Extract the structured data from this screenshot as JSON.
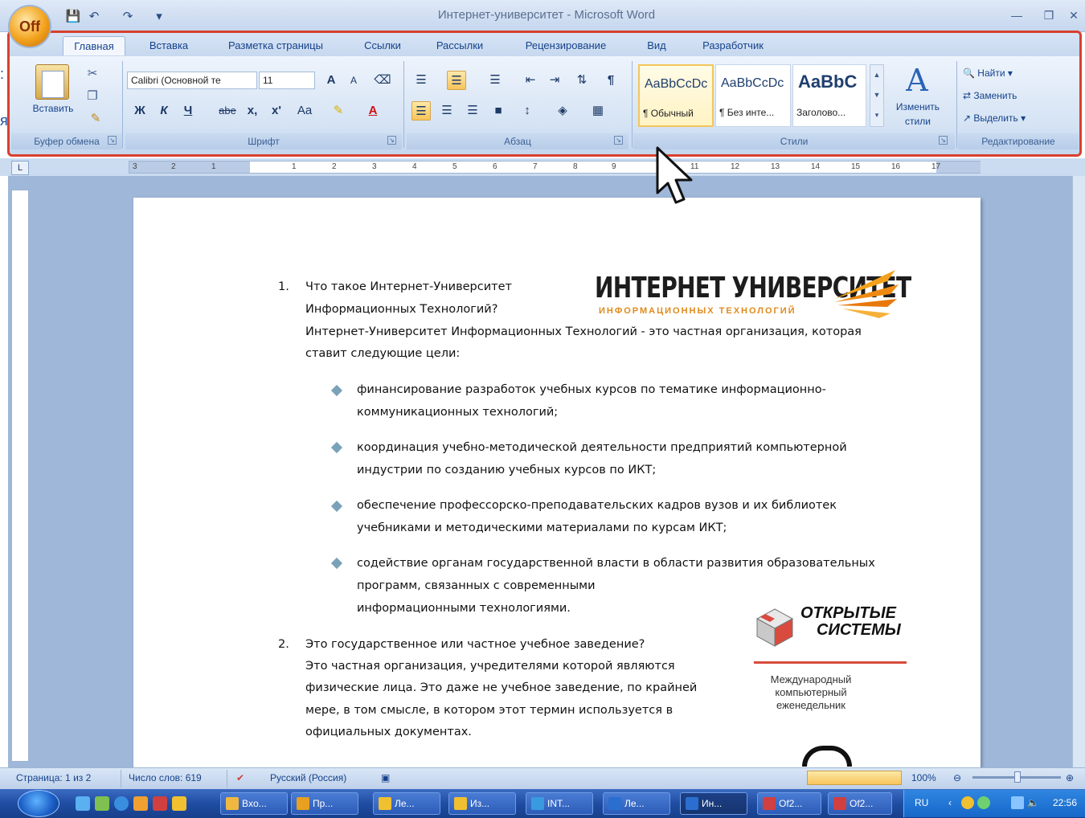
{
  "window": {
    "title": "Интернет-университет - Microsoft Word",
    "office_button": "Off"
  },
  "quick_access": {
    "save_icon": "save-icon",
    "undo_icon": "undo-icon",
    "redo_icon": "redo-icon",
    "customize_icon": "customize-icon"
  },
  "ribbon": {
    "tabs": [
      {
        "label": "Главная",
        "active": true
      },
      {
        "label": "Вставка"
      },
      {
        "label": "Разметка страницы"
      },
      {
        "label": "Ссылки"
      },
      {
        "label": "Рассылки"
      },
      {
        "label": "Рецензирование"
      },
      {
        "label": "Вид"
      },
      {
        "label": "Разработчик"
      }
    ],
    "clipboard": {
      "paste_label": "Вставить",
      "group_label": "Буфер обмена"
    },
    "font": {
      "font_name": "Calibri (Основной те",
      "font_size": "11",
      "group_label": "Шрифт",
      "grow_label": "A",
      "shrink_label": "A",
      "bold_label": "Ж",
      "italic_label": "К",
      "underline_label": "Ч",
      "strike_label": "abe",
      "subscript_label": "x,",
      "superscript_label": "x'",
      "case_label": "Aa",
      "color_label": "A"
    },
    "paragraph": {
      "group_label": "Абзац",
      "show_marks_label": "¶"
    },
    "styles": {
      "group_label": "Стили",
      "cards": [
        {
          "sample": "AaBbCcDc",
          "name": "¶ Обычный",
          "selected": true
        },
        {
          "sample": "AaBbCcDc",
          "name": "¶ Без инте..."
        },
        {
          "sample": "AaBbC",
          "name": "Заголово..."
        }
      ],
      "change_styles_line1": "Изменить",
      "change_styles_line2": "стили"
    },
    "editing": {
      "group_label": "Редактирование",
      "find": "Найти",
      "replace": "Заменить",
      "select": "Выделить"
    }
  },
  "ruler": {
    "ticks": [
      "3",
      "2",
      "1",
      "1",
      "2",
      "3",
      "4",
      "5",
      "6",
      "7",
      "8",
      "9",
      "11",
      "12",
      "13",
      "14",
      "15",
      "16",
      "17"
    ]
  },
  "document": {
    "item1": {
      "number": "1.",
      "line1": "Что такое Интернет-Университет",
      "line2": "Информационных Технологий?",
      "line3": "Интернет-Университет Информационных Технологий - это частная организация, которая",
      "line4": "ставит следующие цели:"
    },
    "bullets": [
      {
        "line1": "финансирование разработок учебных курсов по тематике информационно-",
        "line2": "коммуникационных технологий;"
      },
      {
        "line1": "координация учебно-методической деятельности предприятий компьютерной",
        "line2": "индустрии по созданию учебных курсов по ИКТ;"
      },
      {
        "line1": "обеспечение профессорско-преподавательских кадров вузов и их библиотек",
        "line2": "учебниками и методическими материалами по курсам ИКТ;"
      },
      {
        "line1": "содействие органам государственной власти в области развития образовательных",
        "line2": "программ, связанных с современными",
        "line3": "информационными технологиями."
      }
    ],
    "item2": {
      "number": "2.",
      "line1": "Это государственное или частное учебное заведение?",
      "line2": "Это частная организация, учредителями которой являются",
      "line3": "физические лица. Это даже не учебное заведение, по крайней",
      "line4": "мере, в том смысле, в котором этот термин используется в",
      "line5": "официальных документах."
    },
    "logo1": {
      "main": "ИНТЕРНЕТ УНИВЕРСИТЕТ",
      "sub": "ИНФОРМАЦИОННЫХ ТЕХНОЛОГИЙ"
    },
    "logo2": {
      "title1": "ОТКРЫТЫЕ",
      "title2": "СИСТЕМЫ",
      "sub1": "Международный",
      "sub2": "компьютерный",
      "sub3": "еженедельник"
    }
  },
  "statusbar": {
    "page": "Страница: 1 из 2",
    "words": "Число слов: 619",
    "language": "Русский (Россия)",
    "zoom": "100%"
  },
  "taskbar": {
    "tasks": [
      {
        "label": "Bxo...",
        "color": "#f0b840"
      },
      {
        "label": "Пр...",
        "color": "#e8a020"
      },
      {
        "label": "Ле...",
        "color": "#f0c030"
      },
      {
        "label": "Из...",
        "color": "#f0c030"
      },
      {
        "label": "INT...",
        "color": "#3a9ae0"
      },
      {
        "label": "Ле...",
        "color": "#2a6fd0"
      },
      {
        "label": "Ин...",
        "color": "#2a6fd0",
        "active": true
      },
      {
        "label": "Of2...",
        "color": "#d04040"
      },
      {
        "label": "Of2...",
        "color": "#d04040"
      }
    ],
    "lang": "RU",
    "clock": "22:56"
  },
  "colors": {
    "ribbon_highlight": "#d8402e",
    "logo_orange": "#e08a1b",
    "logo2_red": "#d94b3e"
  }
}
